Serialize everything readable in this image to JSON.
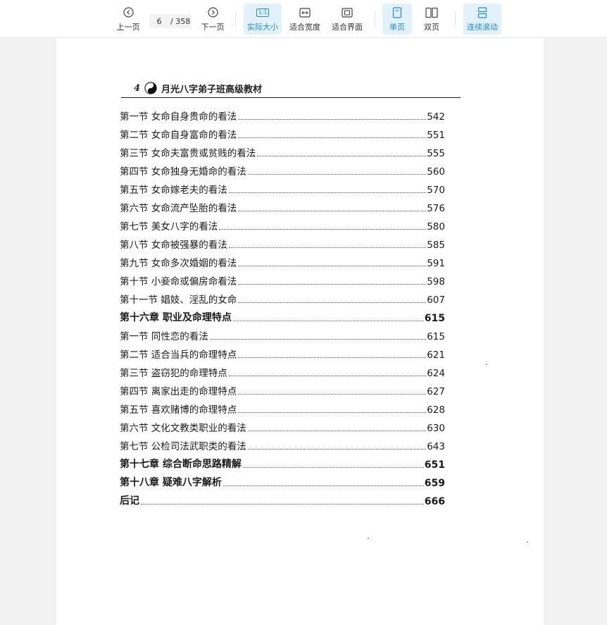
{
  "toolbar": {
    "prev_label": "上一页",
    "next_label": "下一页",
    "current_page": "6",
    "total_pages": "/ 358",
    "actual_size_label": "实际大小",
    "fit_width_label": "适合宽度",
    "fit_page_label": "适合界面",
    "single_page_label": "单页",
    "double_page_label": "双页",
    "continuous_label": "连续滚动",
    "actual_size_icon_text": "1:1",
    "accent_color": "#1e8bd6"
  },
  "document": {
    "page_number": "4",
    "header_title": "月光八字弟子班高级教材",
    "toc": [
      {
        "label": "第一节  女命自身贵命的看法",
        "page": "542",
        "chapter": false
      },
      {
        "label": "第二节  女命自身富命的看法",
        "page": "551",
        "chapter": false
      },
      {
        "label": "第三节  女命夫富贵或贫贱的看法",
        "page": "555",
        "chapter": false
      },
      {
        "label": "第四节  女命独身无婚命的看法",
        "page": "560",
        "chapter": false
      },
      {
        "label": "第五节  女命嫁老夫的看法",
        "page": "570",
        "chapter": false
      },
      {
        "label": "第六节  女命流产坠胎的看法",
        "page": "576",
        "chapter": false
      },
      {
        "label": "第七节  美女八字的看法",
        "page": "580",
        "chapter": false
      },
      {
        "label": "第八节  女命被强暴的看法",
        "page": "585",
        "chapter": false
      },
      {
        "label": "第九节  女命多次婚姻的看法",
        "page": "591",
        "chapter": false
      },
      {
        "label": "第十节  小妾命或偏房命看法",
        "page": "598",
        "chapter": false
      },
      {
        "label": "第十一节  娼妓、淫乱的女命",
        "page": "607",
        "chapter": false
      },
      {
        "label": "第十六章  职业及命理特点",
        "page": "615",
        "chapter": true
      },
      {
        "label": "第一节  同性恋的看法",
        "page": "615",
        "chapter": false
      },
      {
        "label": "第二节  适合当兵的命理特点",
        "page": "621",
        "chapter": false
      },
      {
        "label": "第三节  盗窃犯的命理特点",
        "page": "624",
        "chapter": false
      },
      {
        "label": "第四节  离家出走的命理特点",
        "page": "627",
        "chapter": false
      },
      {
        "label": "第五节  喜欢赌博的命理特点",
        "page": "628",
        "chapter": false
      },
      {
        "label": "第六节  文化文教类职业的看法",
        "page": "630",
        "chapter": false
      },
      {
        "label": "第七节  公检司法武职类的看法",
        "page": "643",
        "chapter": false
      },
      {
        "label": "第十七章  综合断命思路精解",
        "page": "651",
        "chapter": true
      },
      {
        "label": "第十八章   疑难八字解析",
        "page": "659",
        "chapter": true
      },
      {
        "label": "后记",
        "page": "666",
        "chapter": true
      }
    ]
  }
}
